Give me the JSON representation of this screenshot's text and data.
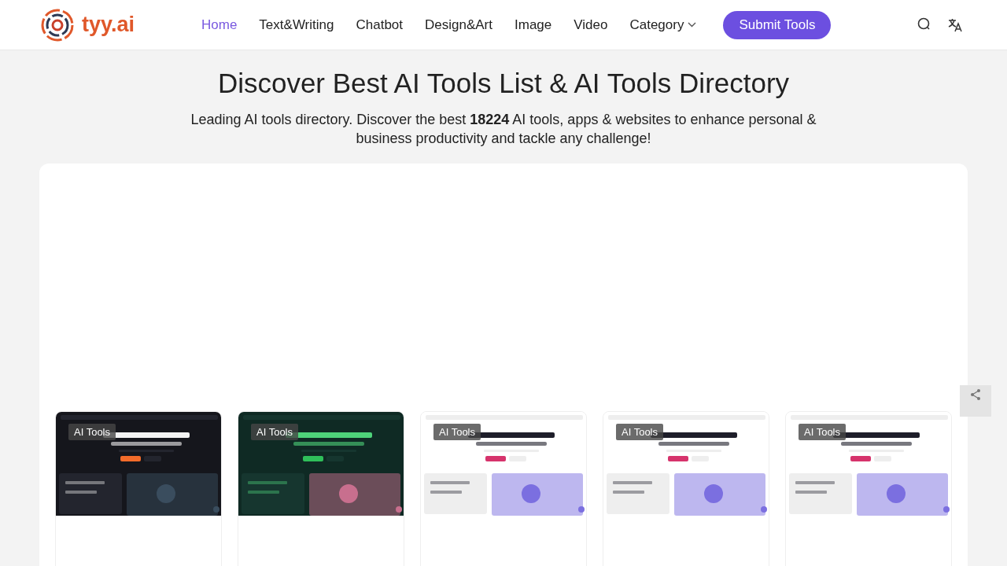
{
  "header": {
    "logo_text": "tyy.ai",
    "nav": [
      {
        "label": "Home",
        "selected": true,
        "has_menu": false
      },
      {
        "label": "Text&Writing",
        "selected": false,
        "has_menu": false
      },
      {
        "label": "Chatbot",
        "selected": false,
        "has_menu": false
      },
      {
        "label": "Design&Art",
        "selected": false,
        "has_menu": false
      },
      {
        "label": "Image",
        "selected": false,
        "has_menu": false
      },
      {
        "label": "Video",
        "selected": false,
        "has_menu": false
      },
      {
        "label": "Category",
        "selected": false,
        "has_menu": true
      }
    ],
    "submit_button": "Submit Tools"
  },
  "hero": {
    "title": "Discover Best AI Tools List & AI Tools Directory",
    "subtitle": "Leading AI tools directory. Discover the best **18224** AI tools, apps & websites to enhance personal & business productivity and tackle any challenge!"
  },
  "tools": [
    {
      "kind": "picture",
      "badge": "AI Tools"
    },
    {
      "kind": "picture",
      "badge": "AI Tools"
    },
    {
      "kind": "picture",
      "badge": "AI Tools"
    },
    {
      "kind": "picture",
      "badge": "AI Tools"
    },
    {
      "kind": "picture",
      "badge": "AI Tools"
    }
  ]
}
